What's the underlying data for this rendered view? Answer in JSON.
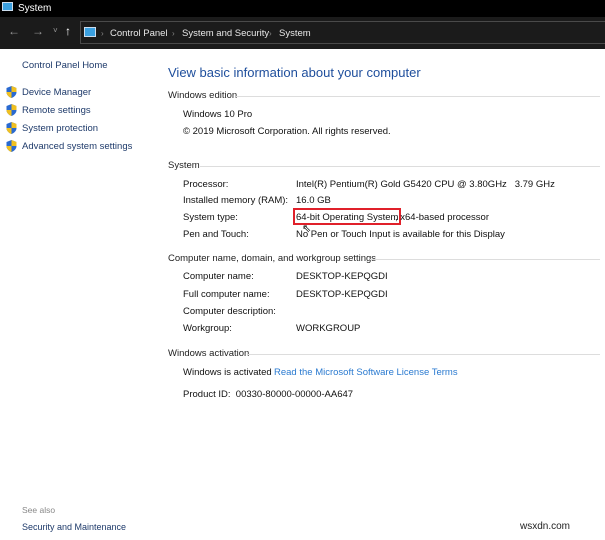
{
  "window": {
    "title": "System",
    "icon": "computer-icon"
  },
  "nav": {
    "back": "←",
    "forward": "→",
    "recent": "˅",
    "up": "↑",
    "breadcrumb": [
      "Control Panel",
      "System and Security",
      "System"
    ],
    "sep": "›"
  },
  "sidebar": {
    "home": "Control Panel Home",
    "items": [
      {
        "label": "Device Manager",
        "icon": "shield-icon"
      },
      {
        "label": "Remote settings",
        "icon": "shield-icon"
      },
      {
        "label": "System protection",
        "icon": "shield-icon"
      },
      {
        "label": "Advanced system settings",
        "icon": "shield-icon"
      }
    ],
    "see_also": "See also",
    "see_also_links": [
      "Security and Maintenance"
    ]
  },
  "main": {
    "title": "View basic information about your computer",
    "edition": {
      "header": "Windows edition",
      "name": "Windows 10 Pro",
      "copyright": "© 2019 Microsoft Corporation. All rights reserved."
    },
    "system": {
      "header": "System",
      "rows": [
        {
          "label": "Processor:",
          "value": "Intel(R) Pentium(R) Gold G5420 CPU @ 3.80GHz   3.79 GHz"
        },
        {
          "label": "Installed memory (RAM):",
          "value": "16.0 GB"
        },
        {
          "label": "System type:",
          "value_highlight": "64-bit Operating System",
          "value": ", x64-based processor"
        },
        {
          "label": "Pen and Touch:",
          "value": "No Pen or Touch Input is available for this Display"
        }
      ]
    },
    "computer": {
      "header": "Computer name, domain, and workgroup settings",
      "rows": [
        {
          "label": "Computer name:",
          "value": "DESKTOP-KEPQGDI"
        },
        {
          "label": "Full computer name:",
          "value": "DESKTOP-KEPQGDI"
        },
        {
          "label": "Computer description:",
          "value": ""
        },
        {
          "label": "Workgroup:",
          "value": "WORKGROUP"
        }
      ]
    },
    "activation": {
      "header": "Windows activation",
      "status": "Windows is activated",
      "license_link": "Read the Microsoft Software License Terms",
      "product_id": "Product ID:  00330-80000-00000-AA647"
    }
  },
  "watermark": "wsxdn.com",
  "colors": {
    "highlight_box": "#e0202a",
    "link": "#1e4e9c"
  }
}
